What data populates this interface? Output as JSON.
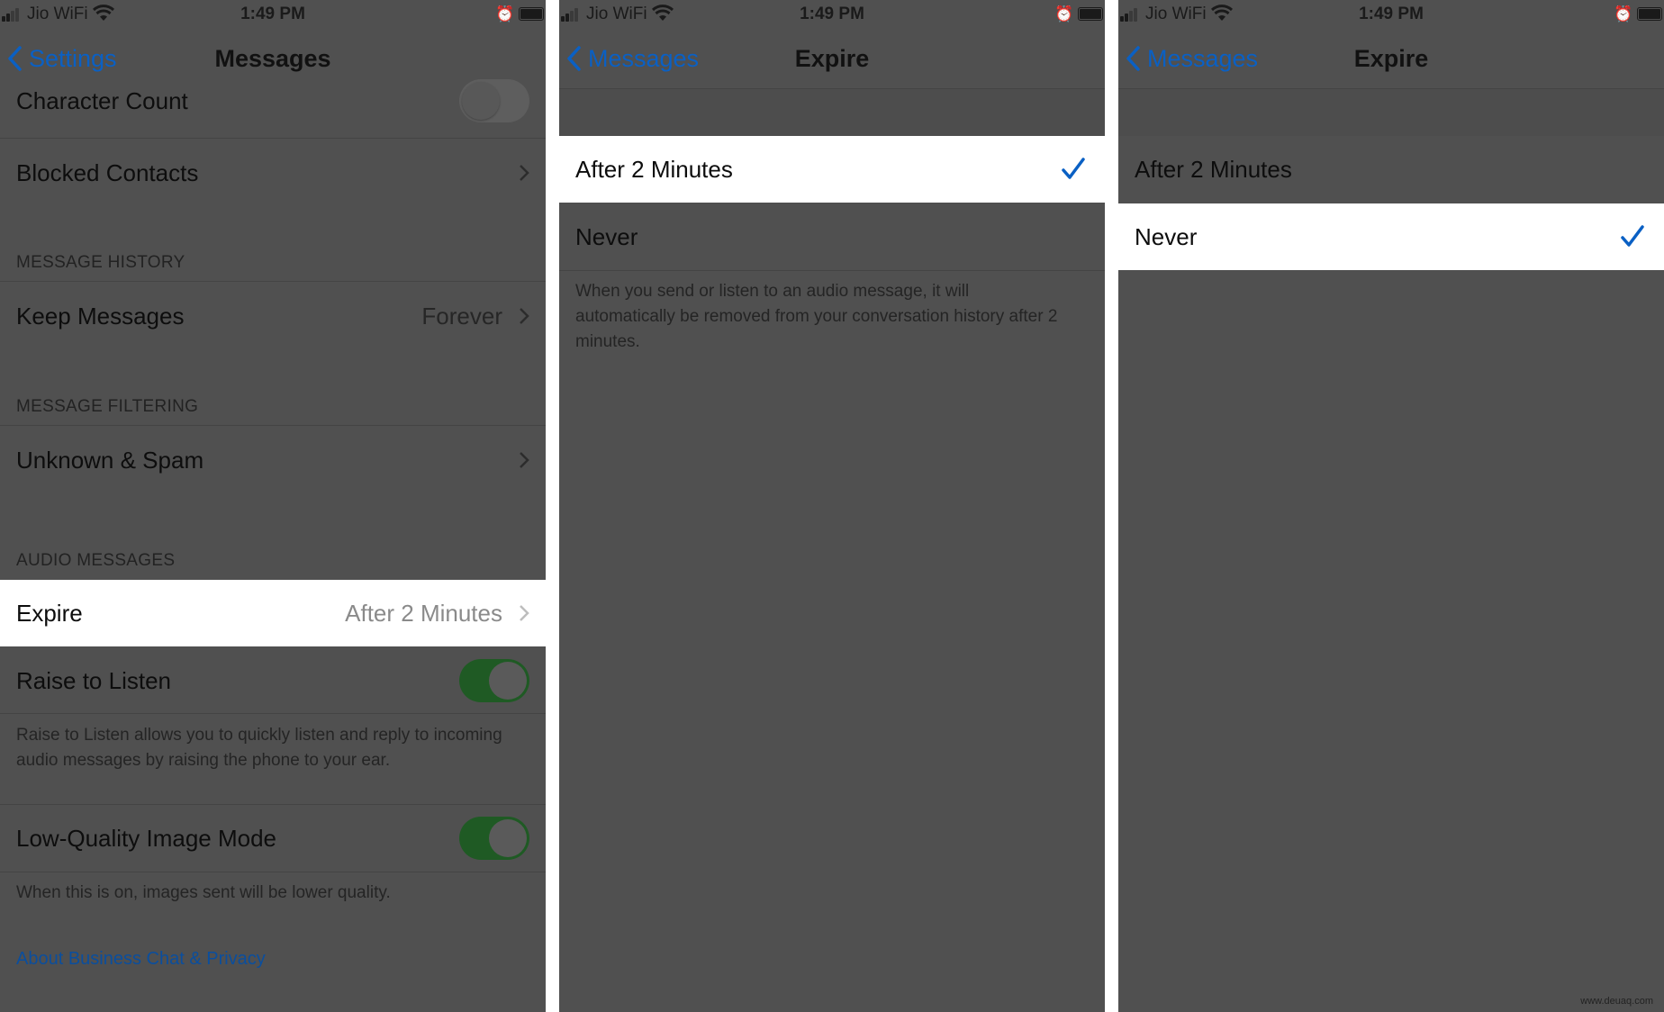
{
  "status": {
    "carrier": "Jio WiFi",
    "time": "1:49 PM"
  },
  "colors": {
    "accent": "#0a60c4",
    "toggle_on": "#1f5a24",
    "highlight": "#ffffff",
    "background": "#505050"
  },
  "panel1": {
    "back_label": "Settings",
    "title": "Messages",
    "character_count": "Character Count",
    "character_count_on": false,
    "blocked_contacts": "Blocked Contacts",
    "history_header": "MESSAGE HISTORY",
    "keep_messages": "Keep Messages",
    "keep_messages_value": "Forever",
    "filtering_header": "MESSAGE FILTERING",
    "unknown_spam": "Unknown & Spam",
    "audio_header": "AUDIO MESSAGES",
    "expire": "Expire",
    "expire_value": "After 2 Minutes",
    "raise_to_listen": "Raise to Listen",
    "raise_to_listen_on": true,
    "raise_note": "Raise to Listen allows you to quickly listen and reply to incoming audio messages by raising the phone to your ear.",
    "low_quality": "Low-Quality Image Mode",
    "low_quality_on": true,
    "low_quality_note": "When this is on, images sent will be lower quality.",
    "about_link": "About Business Chat & Privacy"
  },
  "panel2": {
    "back_label": "Messages",
    "title": "Expire",
    "options": [
      "After 2 Minutes",
      "Never"
    ],
    "selected": "After 2 Minutes",
    "note": "When you send or listen to an audio message, it will automatically be removed from your conversation history after 2 minutes."
  },
  "panel3": {
    "back_label": "Messages",
    "title": "Expire",
    "options": [
      "After 2 Minutes",
      "Never"
    ],
    "selected": "Never"
  },
  "watermark": "www.deuaq.com",
  "icons": [
    "signal-icon",
    "wifi-icon",
    "alarm-icon",
    "battery-icon",
    "back-chevron-icon",
    "chevron-right-icon",
    "checkmark-icon"
  ]
}
